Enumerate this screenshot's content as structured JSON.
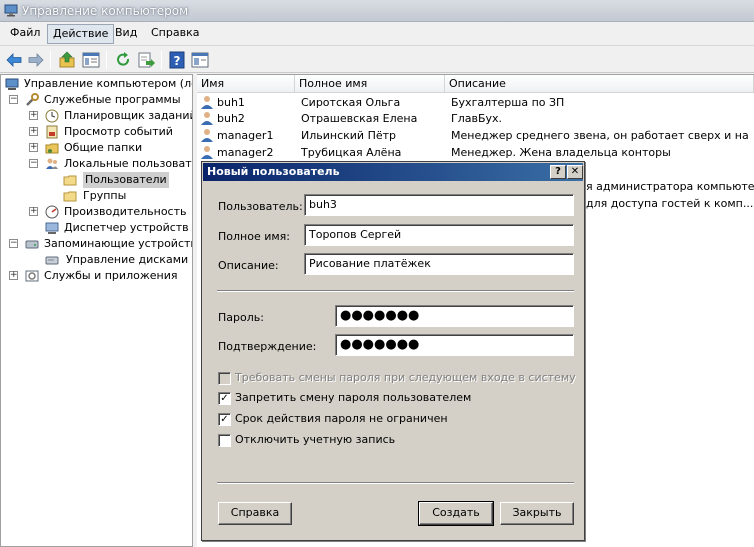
{
  "window": {
    "title": "Управление компьютером"
  },
  "menu": [
    "Файл",
    "Действие",
    "Вид",
    "Справка"
  ],
  "toolbar": {
    "buttons": [
      "back-icon",
      "forward-icon",
      "up-icon",
      "show-hide-tree-icon",
      "refresh-icon",
      "export-icon",
      "help-icon",
      "properties-icon"
    ]
  },
  "tree": {
    "root": "Управление компьютером (лока",
    "system_tools": "Служебные программы",
    "task_scheduler": "Планировщик заданий",
    "event_viewer": "Просмотр событий",
    "shared_folders": "Общие папки",
    "local_users": "Локальные пользовател",
    "users": "Пользователи",
    "groups": "Группы",
    "performance": "Производительность",
    "device_manager": "Диспетчер устройств",
    "storage": "Запоминающие устройства",
    "disk_management": "Управление дисками",
    "services": "Службы и приложения"
  },
  "list": {
    "columns": [
      "Имя",
      "Полное имя",
      "Описание"
    ],
    "rows": [
      {
        "name": "buh1",
        "full_name": "Сиротская Ольга",
        "description": "Бухгалтерша по ЗП"
      },
      {
        "name": "buh2",
        "full_name": "Отрашевская Елена",
        "description": "ГлавБух."
      },
      {
        "name": "manager1",
        "full_name": "Ильинский Пётр",
        "description": "Менеджер среднего звена, он работает сверх и на ."
      },
      {
        "name": "manager2",
        "full_name": "Трубицкая Алёна",
        "description": "Менеджер. Жена владельца конторы"
      }
    ],
    "partial_rows": [
      "я администратора компьюте...",
      "для доступа гостей к комп..."
    ]
  },
  "dialog": {
    "title": "Новый пользователь",
    "help_glyph": "?",
    "close_glyph": "✕",
    "username_label": "Пользователь:",
    "username_value": "buh3",
    "fullname_label": "Полное имя:",
    "fullname_value": "Торопов Сергей",
    "description_label": "Описание:",
    "description_value": "Рисование платёжек",
    "password_label": "Пароль:",
    "password_value": "●●●●●●●",
    "confirm_label": "Подтверждение:",
    "confirm_value": "●●●●●●●",
    "checkboxes": [
      {
        "label": "Требовать смены пароля при следующем входе в систему",
        "checked": false,
        "disabled": true
      },
      {
        "label": "Запретить смену пароля пользователем",
        "checked": true,
        "disabled": false
      },
      {
        "label": "Срок действия пароля не ограничен",
        "checked": true,
        "disabled": false
      },
      {
        "label": "Отключить учетную запись",
        "checked": false,
        "disabled": false
      }
    ],
    "check_glyph": "✓",
    "help_button": "Справка",
    "create_button": "Создать",
    "close_button": "Закрыть"
  }
}
